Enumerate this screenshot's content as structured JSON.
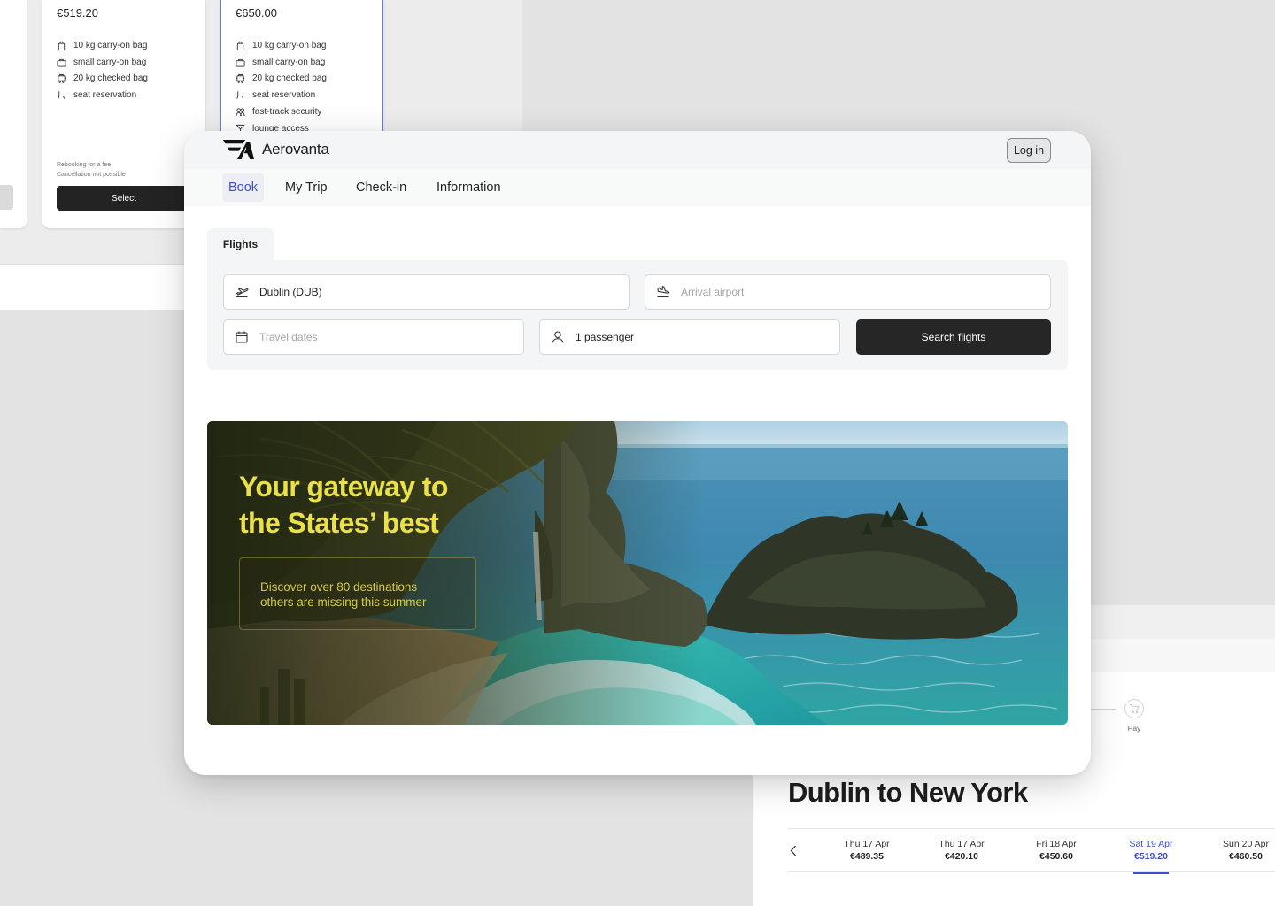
{
  "app": {
    "name": "Aerovanta"
  },
  "header": {
    "login_label": "Log in"
  },
  "nav": {
    "items": [
      {
        "label": "Book",
        "active": true
      },
      {
        "label": "My Trip",
        "active": false
      },
      {
        "label": "Check-in",
        "active": false
      },
      {
        "label": "Information",
        "active": false
      }
    ]
  },
  "search": {
    "tab_label": "Flights",
    "from_value": "Dublin (DUB)",
    "to_placeholder": "Arrival airport",
    "dates_placeholder": "Travel dates",
    "passengers_value": "1 passenger",
    "submit_label": "Search flights"
  },
  "hero": {
    "title_line1": "Your gateway to",
    "title_line2": "the States’ best",
    "subtitle_line1": "Discover over 80 destinations",
    "subtitle_line2": "others are missing this summer"
  },
  "fares": {
    "cards": [
      {
        "price": "€519.20",
        "features": [
          "10 kg carry-on bag",
          "small carry-on bag",
          "20 kg checked bag",
          "seat reservation"
        ],
        "note_line1": "Rebooking for a fee",
        "note_line2": "Cancellation not possible",
        "select_label": "Select"
      },
      {
        "price": "€650.00",
        "features": [
          "10 kg carry-on bag",
          "small carry-on bag",
          "20 kg checked bag",
          "seat reservation",
          "fast-track security",
          "lounge access"
        ]
      }
    ]
  },
  "results": {
    "step_label": "Pay",
    "route_title": "Dublin to New York",
    "dates": [
      {
        "day": "Thu 17 Apr",
        "price": "€489.35",
        "active": false
      },
      {
        "day": "Thu 17 Apr",
        "price": "€420.10",
        "active": false
      },
      {
        "day": "Fri 18 Apr",
        "price": "€450.60",
        "active": false
      },
      {
        "day": "Sat 19 Apr",
        "price": "€519.20",
        "active": true
      },
      {
        "day": "Sun 20 Apr",
        "price": "€460.50",
        "active": false
      }
    ]
  },
  "colors": {
    "accent": "#3b4fc7",
    "button_dark": "#262626",
    "hero_text": "#e9e04a",
    "page_bg": "#e3e3e3"
  },
  "icons": {
    "departure": "plane-takeoff-icon",
    "arrival": "plane-landing-icon",
    "calendar": "calendar-icon",
    "passenger": "user-icon",
    "cart": "cart-icon"
  }
}
